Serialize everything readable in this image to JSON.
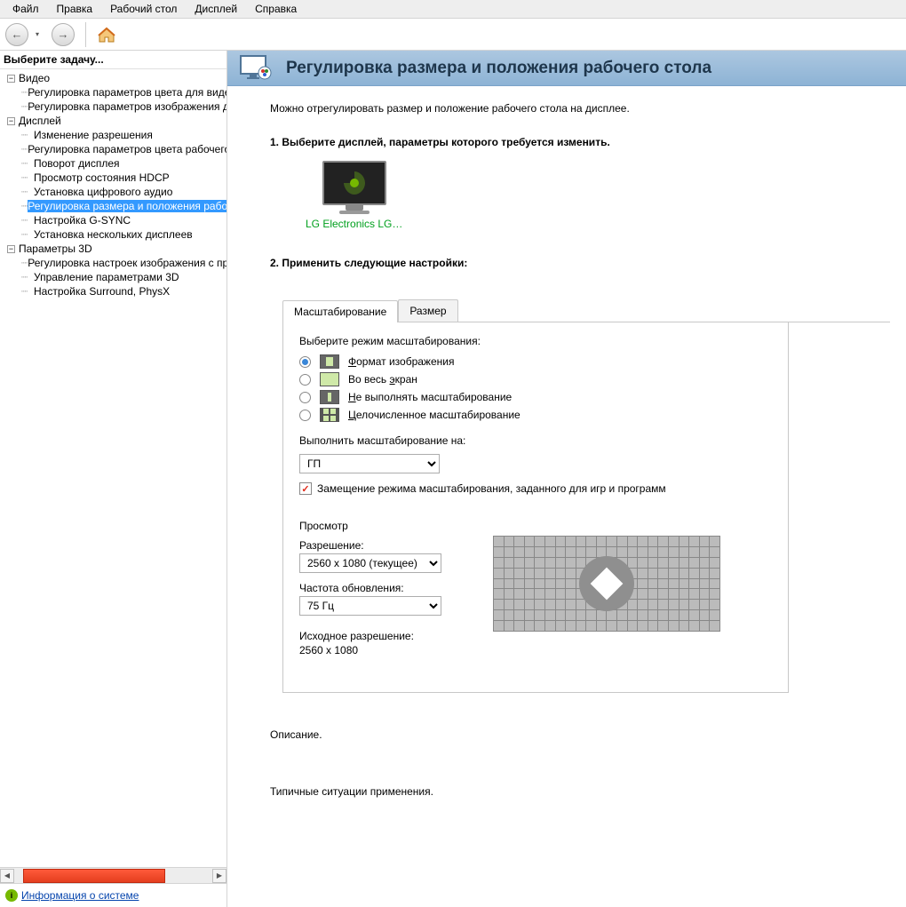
{
  "menu": {
    "file": "Файл",
    "edit": "Правка",
    "desktop": "Рабочий стол",
    "display": "Дисплей",
    "help": "Справка"
  },
  "sidebar": {
    "header": "Выберите задачу...",
    "groups": [
      {
        "label": "Видео",
        "items": [
          "Регулировка параметров цвета для видео",
          "Регулировка параметров изображения для видео"
        ]
      },
      {
        "label": "Дисплей",
        "items": [
          "Изменение разрешения",
          "Регулировка параметров цвета рабочего стола",
          "Поворот дисплея",
          "Просмотр состояния HDCP",
          "Установка цифрового аудио",
          "Регулировка размера и положения рабочего стола",
          "Настройка G-SYNC",
          "Установка нескольких дисплеев"
        ]
      },
      {
        "label": "Параметры 3D",
        "items": [
          "Регулировка настроек изображения с просмотром",
          "Управление параметрами 3D",
          "Настройка Surround, PhysX"
        ]
      }
    ],
    "footer_link": "Информация о системе"
  },
  "page": {
    "title": "Регулировка размера и положения рабочего стола",
    "intro": "Можно отрегулировать размер и положение рабочего стола на дисплее.",
    "step1": "1. Выберите дисплей, параметры которого требуется изменить.",
    "display_name": "LG Electronics LG…",
    "step2": "2. Применить следующие настройки:",
    "tabs": {
      "scaling": "Масштабирование",
      "size": "Размер"
    },
    "scaling": {
      "mode_label": "Выберите режим масштабирования:",
      "options": [
        "Формат изображения",
        "Во весь экран",
        "Не выполнять масштабирование",
        "Целочисленное масштабирование"
      ],
      "perform_label": "Выполнить масштабирование на:",
      "perform_value": "ГП",
      "override": "Замещение режима масштабирования, заданного для игр и программ",
      "preview_label": "Просмотр",
      "res_label": "Разрешение:",
      "res_value": "2560 x 1080 (текущее)",
      "refresh_label": "Частота обновления:",
      "refresh_value": "75 Гц",
      "native_label": "Исходное разрешение:",
      "native_value": "2560 x 1080"
    },
    "description": "Описание.",
    "usage": "Типичные ситуации применения."
  }
}
